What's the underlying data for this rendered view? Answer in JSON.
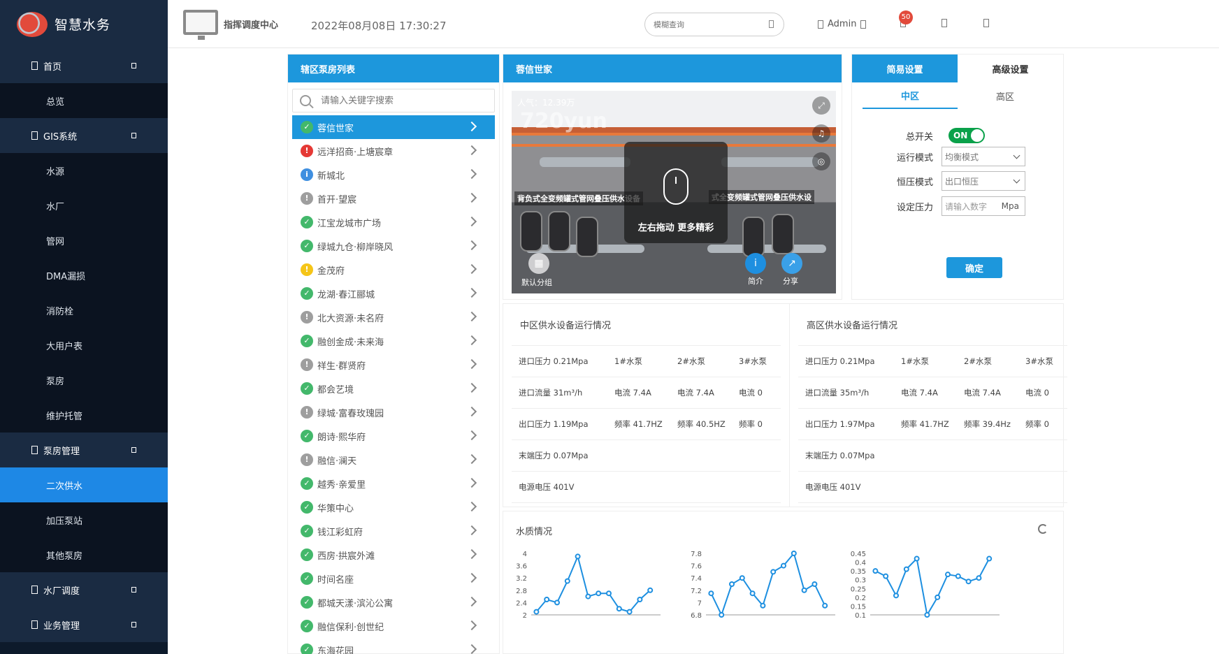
{
  "app": {
    "title": "智慧水务",
    "command_center": "指挥调度中心",
    "datetime": "2022年08月08日 17:30:27",
    "search_placeholder": "模糊查询",
    "user": "Admin",
    "notifications": "50"
  },
  "sidebar": {
    "groups": [
      {
        "label": "首页",
        "items": [
          "总览"
        ]
      },
      {
        "label": "GIS系统",
        "items": [
          "水源",
          "水厂",
          "管网",
          "DMA漏损",
          "消防栓",
          "大用户表",
          "泵房",
          "维护托管"
        ]
      },
      {
        "label": "泵房管理",
        "items": [
          "二次供水",
          "加压泵站",
          "其他泵房"
        ]
      },
      {
        "label": "水厂调度",
        "items": []
      },
      {
        "label": "业务管理",
        "items": []
      }
    ],
    "active_item": "二次供水"
  },
  "pump_list": {
    "title": "辖区泵房列表",
    "search_placeholder": "请输入关键字搜索",
    "items": [
      {
        "name": "蓉信世家",
        "status": "ok"
      },
      {
        "name": "远洋招商·上塘宸章",
        "status": "err"
      },
      {
        "name": "新城北",
        "status": "info"
      },
      {
        "name": "首开·望宸",
        "status": "off"
      },
      {
        "name": "江宝龙城市广场",
        "status": "ok"
      },
      {
        "name": "绿城九仓·柳岸晓风",
        "status": "ok"
      },
      {
        "name": "金茂府",
        "status": "warn"
      },
      {
        "name": "龙湖·春江郦城",
        "status": "ok"
      },
      {
        "name": "北大资源·未名府",
        "status": "off"
      },
      {
        "name": "融创金成·未来海",
        "status": "ok"
      },
      {
        "name": "祥生·群贤府",
        "status": "off"
      },
      {
        "name": "都会艺境",
        "status": "ok"
      },
      {
        "name": "绿城·富春玫瑰园",
        "status": "off"
      },
      {
        "name": "朗诗·熙华府",
        "status": "ok"
      },
      {
        "name": "融信·澜天",
        "status": "off"
      },
      {
        "name": "越秀·亲爱里",
        "status": "ok"
      },
      {
        "name": "华策中心",
        "status": "ok"
      },
      {
        "name": "钱江彩虹府",
        "status": "ok"
      },
      {
        "name": "西房·拱宸外滩",
        "status": "ok"
      },
      {
        "name": "时间名座",
        "status": "ok"
      },
      {
        "name": "都城天漾·滨沁公寓",
        "status": "ok"
      },
      {
        "name": "融信保利·创世纪",
        "status": "ok"
      },
      {
        "name": "东海花园",
        "status": "ok"
      }
    ]
  },
  "panorama": {
    "title": "蓉信世家",
    "popularity": "人气：12.39万",
    "logo": "720yun",
    "hint": "左右拖动 更多精彩",
    "label_left": "背负式全变频罐式管网叠压供水设备",
    "label_right": "式全变频罐式管网叠压供水设",
    "default_group": "默认分组",
    "intro": "简介",
    "share": "分享"
  },
  "settings": {
    "tabs": [
      "简易设置",
      "高级设置"
    ],
    "zones": [
      "中区",
      "高区"
    ],
    "master_switch_label": "总开关",
    "master_switch": "ON",
    "run_mode_label": "运行模式",
    "run_mode": "均衡模式",
    "const_mode_label": "恒压模式",
    "const_mode": "出口恒压",
    "set_pressure_label": "设定压力",
    "set_pressure_placeholder": "请输入数字",
    "set_pressure_unit": "Mpa",
    "confirm": "确定"
  },
  "equipment": {
    "mid": {
      "title": "中区供水设备运行情况",
      "rows": [
        [
          "进口压力  0.21Mpa",
          "1#水泵",
          "2#水泵",
          "3#水泵"
        ],
        [
          "进口流量 31m³/h",
          "电流 7.4A",
          "电流 7.4A",
          "电流 0"
        ],
        [
          "出口压力  1.19Mpa",
          "频率 41.7HZ",
          "频率 40.5HZ",
          "频率 0"
        ],
        [
          "末端压力  0.07Mpa",
          "",
          "",
          ""
        ],
        [
          "电源电压      401V",
          "",
          "",
          ""
        ]
      ]
    },
    "high": {
      "title": "高区供水设备运行情况",
      "rows": [
        [
          "进口压力  0.21Mpa",
          "1#水泵",
          "2#水泵",
          "3#水泵"
        ],
        [
          "进口流量  35m³/h",
          "电流 7.4A",
          "电流 7.4A",
          "电流 0"
        ],
        [
          "出口压力  1.97Mpa",
          "频率 41.7HZ",
          "频率 39.4Hz",
          "频率 0"
        ],
        [
          "末端压力  0.07Mpa",
          "",
          "",
          ""
        ],
        [
          "电源电压  401V",
          "",
          "",
          ""
        ]
      ]
    }
  },
  "water_quality": {
    "title": "水质情况",
    "color": "#1d8fe0"
  },
  "chart_data": [
    {
      "type": "line",
      "ylim": [
        2,
        4
      ],
      "yticks": [
        "4",
        "3.6",
        "3.2",
        "2.8",
        "2.4",
        "2"
      ],
      "values": [
        2.1,
        2.5,
        2.4,
        3.1,
        3.9,
        2.6,
        2.7,
        2.7,
        2.2,
        2.1,
        2.5,
        2.8
      ]
    },
    {
      "type": "line",
      "ylim": [
        6.8,
        7.8
      ],
      "yticks": [
        "7.8",
        "7.6",
        "7.4",
        "7.2",
        "7",
        "6.8"
      ],
      "values": [
        7.15,
        6.8,
        7.3,
        7.4,
        7.15,
        6.95,
        7.5,
        7.6,
        7.8,
        7.2,
        7.3,
        6.95
      ]
    },
    {
      "type": "line",
      "ylim": [
        0.1,
        0.45
      ],
      "yticks": [
        "0.45",
        "0.4",
        "0.35",
        "0.3",
        "0.25",
        "0.2",
        "0.15",
        "0.1"
      ],
      "values": [
        0.35,
        0.32,
        0.21,
        0.36,
        0.42,
        0.1,
        0.2,
        0.33,
        0.32,
        0.29,
        0.31,
        0.42
      ]
    }
  ]
}
